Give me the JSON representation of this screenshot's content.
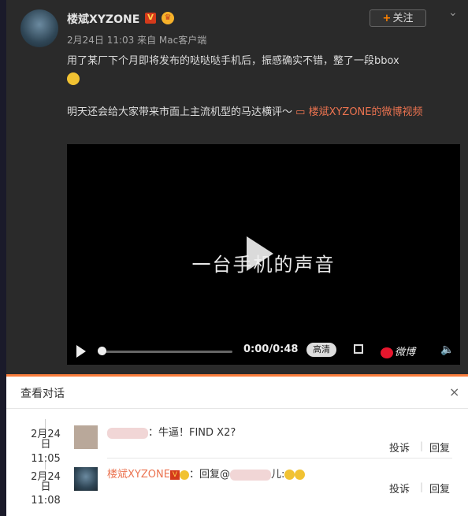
{
  "post": {
    "username": "楼斌XYZONE",
    "v_badge": "V",
    "follow_label": "关注",
    "follow_plus": "+",
    "menu_chevron": "⌄",
    "meta": "2月24日 11:03 来自 Mac客户端",
    "text_line1": "用了某厂下个月即将发布的哒哒哒手机后，振感确实不错，整了一段bbox",
    "text_line2_a": "明天还会给大家带来市面上主流机型的马达横评～ ",
    "link_label": "楼斌XYZONE的微博视频",
    "link_icon": "video-icon"
  },
  "video": {
    "caption": "一台手机的声音",
    "time": "0:00/0:48",
    "hd_label": "高清",
    "brand_label": "微博",
    "progress": 0
  },
  "dialog": {
    "title": "查看对话",
    "close": "×",
    "comments": [
      {
        "date": "2月24日",
        "time": "11:05",
        "text": "：牛逼！FIND X2?",
        "report": "投诉",
        "reply": "回复"
      },
      {
        "date": "2月24日",
        "time": "11:08",
        "name": "楼斌XYZONE",
        "text_prefix": "：回复@",
        "text_suffix": "儿:",
        "report": "投诉",
        "reply": "回复"
      }
    ]
  },
  "colors": {
    "accent": "#eb7350",
    "dialog_border": "#fa7d3c"
  }
}
